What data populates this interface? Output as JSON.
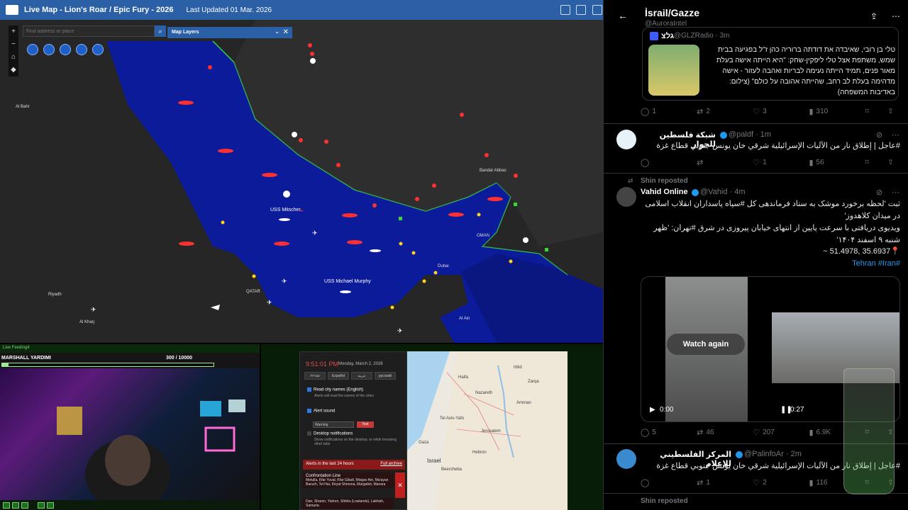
{
  "map": {
    "title": "Live Map - Lion's Roar / Epic Fury - 2026",
    "updated": "Last Updated 01 Mar. 2026",
    "search_placeholder": "Find address or place",
    "layers_label": "Map Layers",
    "zoom_in": "+",
    "zoom_out": "−",
    "place_labels": [
      {
        "text": "Al Bahr"
      },
      {
        "text": "Riyadh"
      },
      {
        "text": "Al Kharj"
      },
      {
        "text": "QATAR"
      },
      {
        "text": "Bandar Abbas"
      },
      {
        "text": "Dubai"
      },
      {
        "text": "Al Ain"
      },
      {
        "text": "OMAN"
      }
    ],
    "ships": [
      {
        "text": "USS Mitscher"
      },
      {
        "text": "USS Michael Murphy"
      }
    ]
  },
  "feed": {
    "top_label": "Live Feeding4",
    "name": "MARSHALL YARDIMI",
    "score": "300",
    "score_max": "/ 10000",
    "progress": 0.03
  },
  "alert_app": {
    "time": "9:51:01 PM",
    "date": "Monday, March 2, 2026",
    "languages": [
      "עברית",
      "Español",
      "عربية",
      "русский"
    ],
    "read_city_title": "Read city names (English)",
    "read_city_sub": "Alerts will read the names of the cities",
    "alert_sound": "Alert sound",
    "warning": "Warning",
    "test": "Test",
    "desktop_title": "Desktop notifications",
    "desktop_sub": "Show notifications on the desktop, or while browsing other tabs",
    "alerts_head": "Alerts in the last 24 hours",
    "full_archive": "Full archive",
    "alert1_title": "Confrontation Line",
    "alert1_body": "Metulla, Kfar Yuval, Kfar Giladi, Misgav Am, Ma'ayan Baruch, Tel Hai, Kiryat Shmona, Margaliot, Manara",
    "alert2_body": "Dan, Sharon, Yarkon, Shfela (Lowlands), Lakhish, Samaria"
  },
  "israel_map": {
    "cities": [
      "Haifa",
      "Nazareth",
      "Tel Aviv-Yafo",
      "Amman",
      "Jerusalem",
      "Gaza",
      "Beersheba",
      "Israel",
      "Zarqa",
      "Irbid",
      "Hebron"
    ]
  },
  "twitter": {
    "title": "İsrail/Gazze",
    "handle": "@AuroraIntel",
    "quote_name": "גלצ",
    "quote_handle": "@GLZRadio · 3m",
    "quote_text": "טלי בן רובי, שאיבדה את דודתה ברוריה כהן ז\"ל בפגיעה בבית שמש, משתפת אצל טלי ליפקין-שחק: \"היא הייתה אישה בעלת מאור פנים, תמיד הייתה נעימה לבריות ואהבה לעזור - אישה מדהימה בעלת לב רחב, שהייתה אהובה על כולם\" (צילום: באדיבות המשפחה)",
    "t1_stats": [
      "1",
      "2",
      "3",
      "310"
    ],
    "t2_name": "شبكة فلسطين للحوار",
    "t2_handle": "@paldf · 1m",
    "t2_text": "#عاجل | إطلاق نار من الآليات الإسرائيلية شرقي خان يونس جنوبي قطاع غزة",
    "t2_stats": [
      "",
      "",
      "1",
      "56"
    ],
    "reposted": "Shin reposted",
    "t3_name": "Vahid Online",
    "t3_handle": "@Vahid · 4m",
    "t3_line1": "ثبت 'لحظه برخورد موشک به ستاد فرماندهی کل #سپاه پاسداران انقلاب اسلامی در میدان کلاهدوز'",
    "t3_line2": "ویدیوی دریافتی با سرعت پایین از انتهای خیابان پیروزی در شرق #تهران: 'ظهر شنبه ۹ اسفند ۱۴۰۴'",
    "t3_line3": "📍35.6937 ,51.4978 ~",
    "t3_tags": "#Tehran #Iran",
    "watch_again": "Watch again",
    "time_a": "0:00",
    "time_b": "0:27",
    "t3_stats": [
      "5",
      "46",
      "207",
      "6.9K"
    ],
    "t4_name": "المركز الفلسطيني للإعلام",
    "t4_handle": "@PalinfoAr · 2m",
    "t4_text": "#عاجل | إطلاق نار من الآليات الإسرائيلية شرقي خان يونس جنوبي قطاع غزة",
    "t4_stats": [
      "",
      "1",
      "2",
      "116"
    ],
    "reposted2": "Shin reposted"
  },
  "colors": {
    "accent": "#2b5fa6",
    "sea": "#0a1a8a",
    "twitter_blue": "#1d9bf0"
  }
}
